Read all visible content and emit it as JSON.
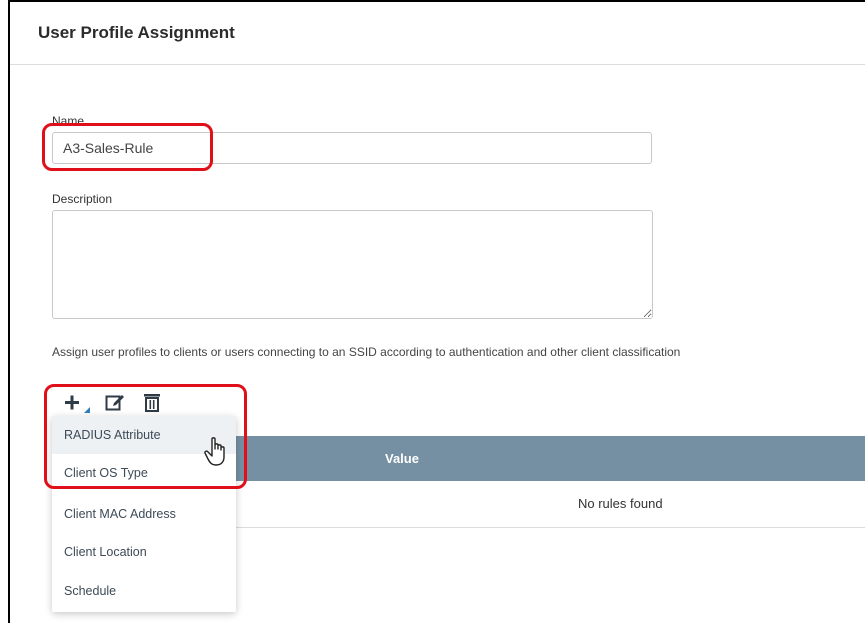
{
  "panel": {
    "title": "User Profile Assignment"
  },
  "form": {
    "name_label": "Name",
    "name_value": "A3-Sales-Rule",
    "description_label": "Description",
    "description_value": "",
    "instructions": "Assign user profiles to clients or users connecting to an SSID according to authentication and other client classification"
  },
  "toolbar": {
    "icons": [
      "plus-icon",
      "edit-icon",
      "trash-icon"
    ]
  },
  "add_menu": {
    "items": [
      {
        "label": "RADIUS Attribute"
      },
      {
        "label": "Client OS Type"
      },
      {
        "label": "Client MAC Address"
      },
      {
        "label": "Client Location"
      },
      {
        "label": "Schedule"
      }
    ]
  },
  "rules_table": {
    "columns": [
      "Value"
    ],
    "empty_text": "No rules found"
  },
  "colors": {
    "header_bg": "#7590a2",
    "highlight": "#e0101a",
    "menu_hover": "#edf1f4"
  }
}
